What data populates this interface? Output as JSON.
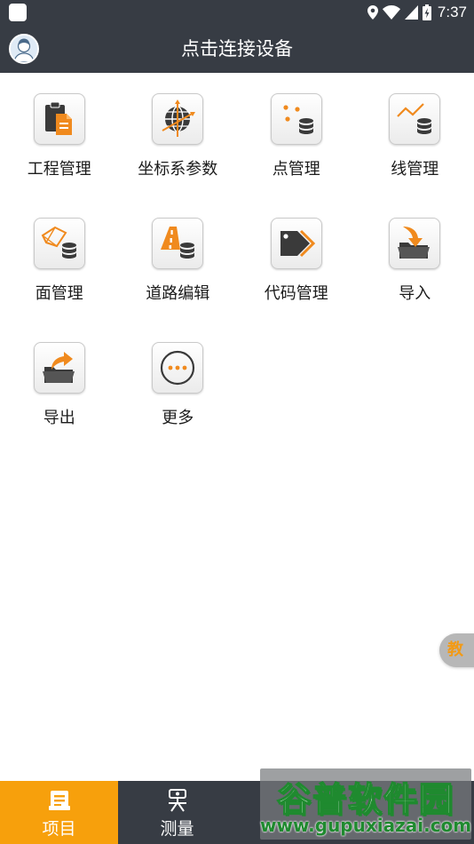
{
  "status_bar": {
    "time": "7:37"
  },
  "header": {
    "title": "点击连接设备"
  },
  "grid": {
    "items": [
      {
        "label": "工程管理",
        "icon": "clipboard-document-icon"
      },
      {
        "label": "坐标系参数",
        "icon": "globe-axes-icon"
      },
      {
        "label": "点管理",
        "icon": "points-database-icon"
      },
      {
        "label": "线管理",
        "icon": "polyline-database-icon"
      },
      {
        "label": "面管理",
        "icon": "polygon-database-icon"
      },
      {
        "label": "道路编辑",
        "icon": "road-database-icon"
      },
      {
        "label": "代码管理",
        "icon": "tag-code-icon"
      },
      {
        "label": "导入",
        "icon": "folder-import-icon"
      },
      {
        "label": "导出",
        "icon": "folder-export-icon"
      },
      {
        "label": "更多",
        "icon": "more-dots-icon"
      }
    ]
  },
  "float_tab": {
    "label": "教"
  },
  "bottom_nav": {
    "tabs": [
      {
        "label": "项目",
        "icon": "project-icon",
        "active": true
      },
      {
        "label": "测量",
        "icon": "survey-instrument-icon",
        "active": false
      }
    ]
  },
  "watermark": {
    "logo": "谷普软件园",
    "url": "www.gupuxiazai.com"
  },
  "colors": {
    "bar_bg": "#373c44",
    "accent": "#f7a00c",
    "icon_orange": "#f08a1e",
    "icon_dark": "#3a3a3a"
  }
}
